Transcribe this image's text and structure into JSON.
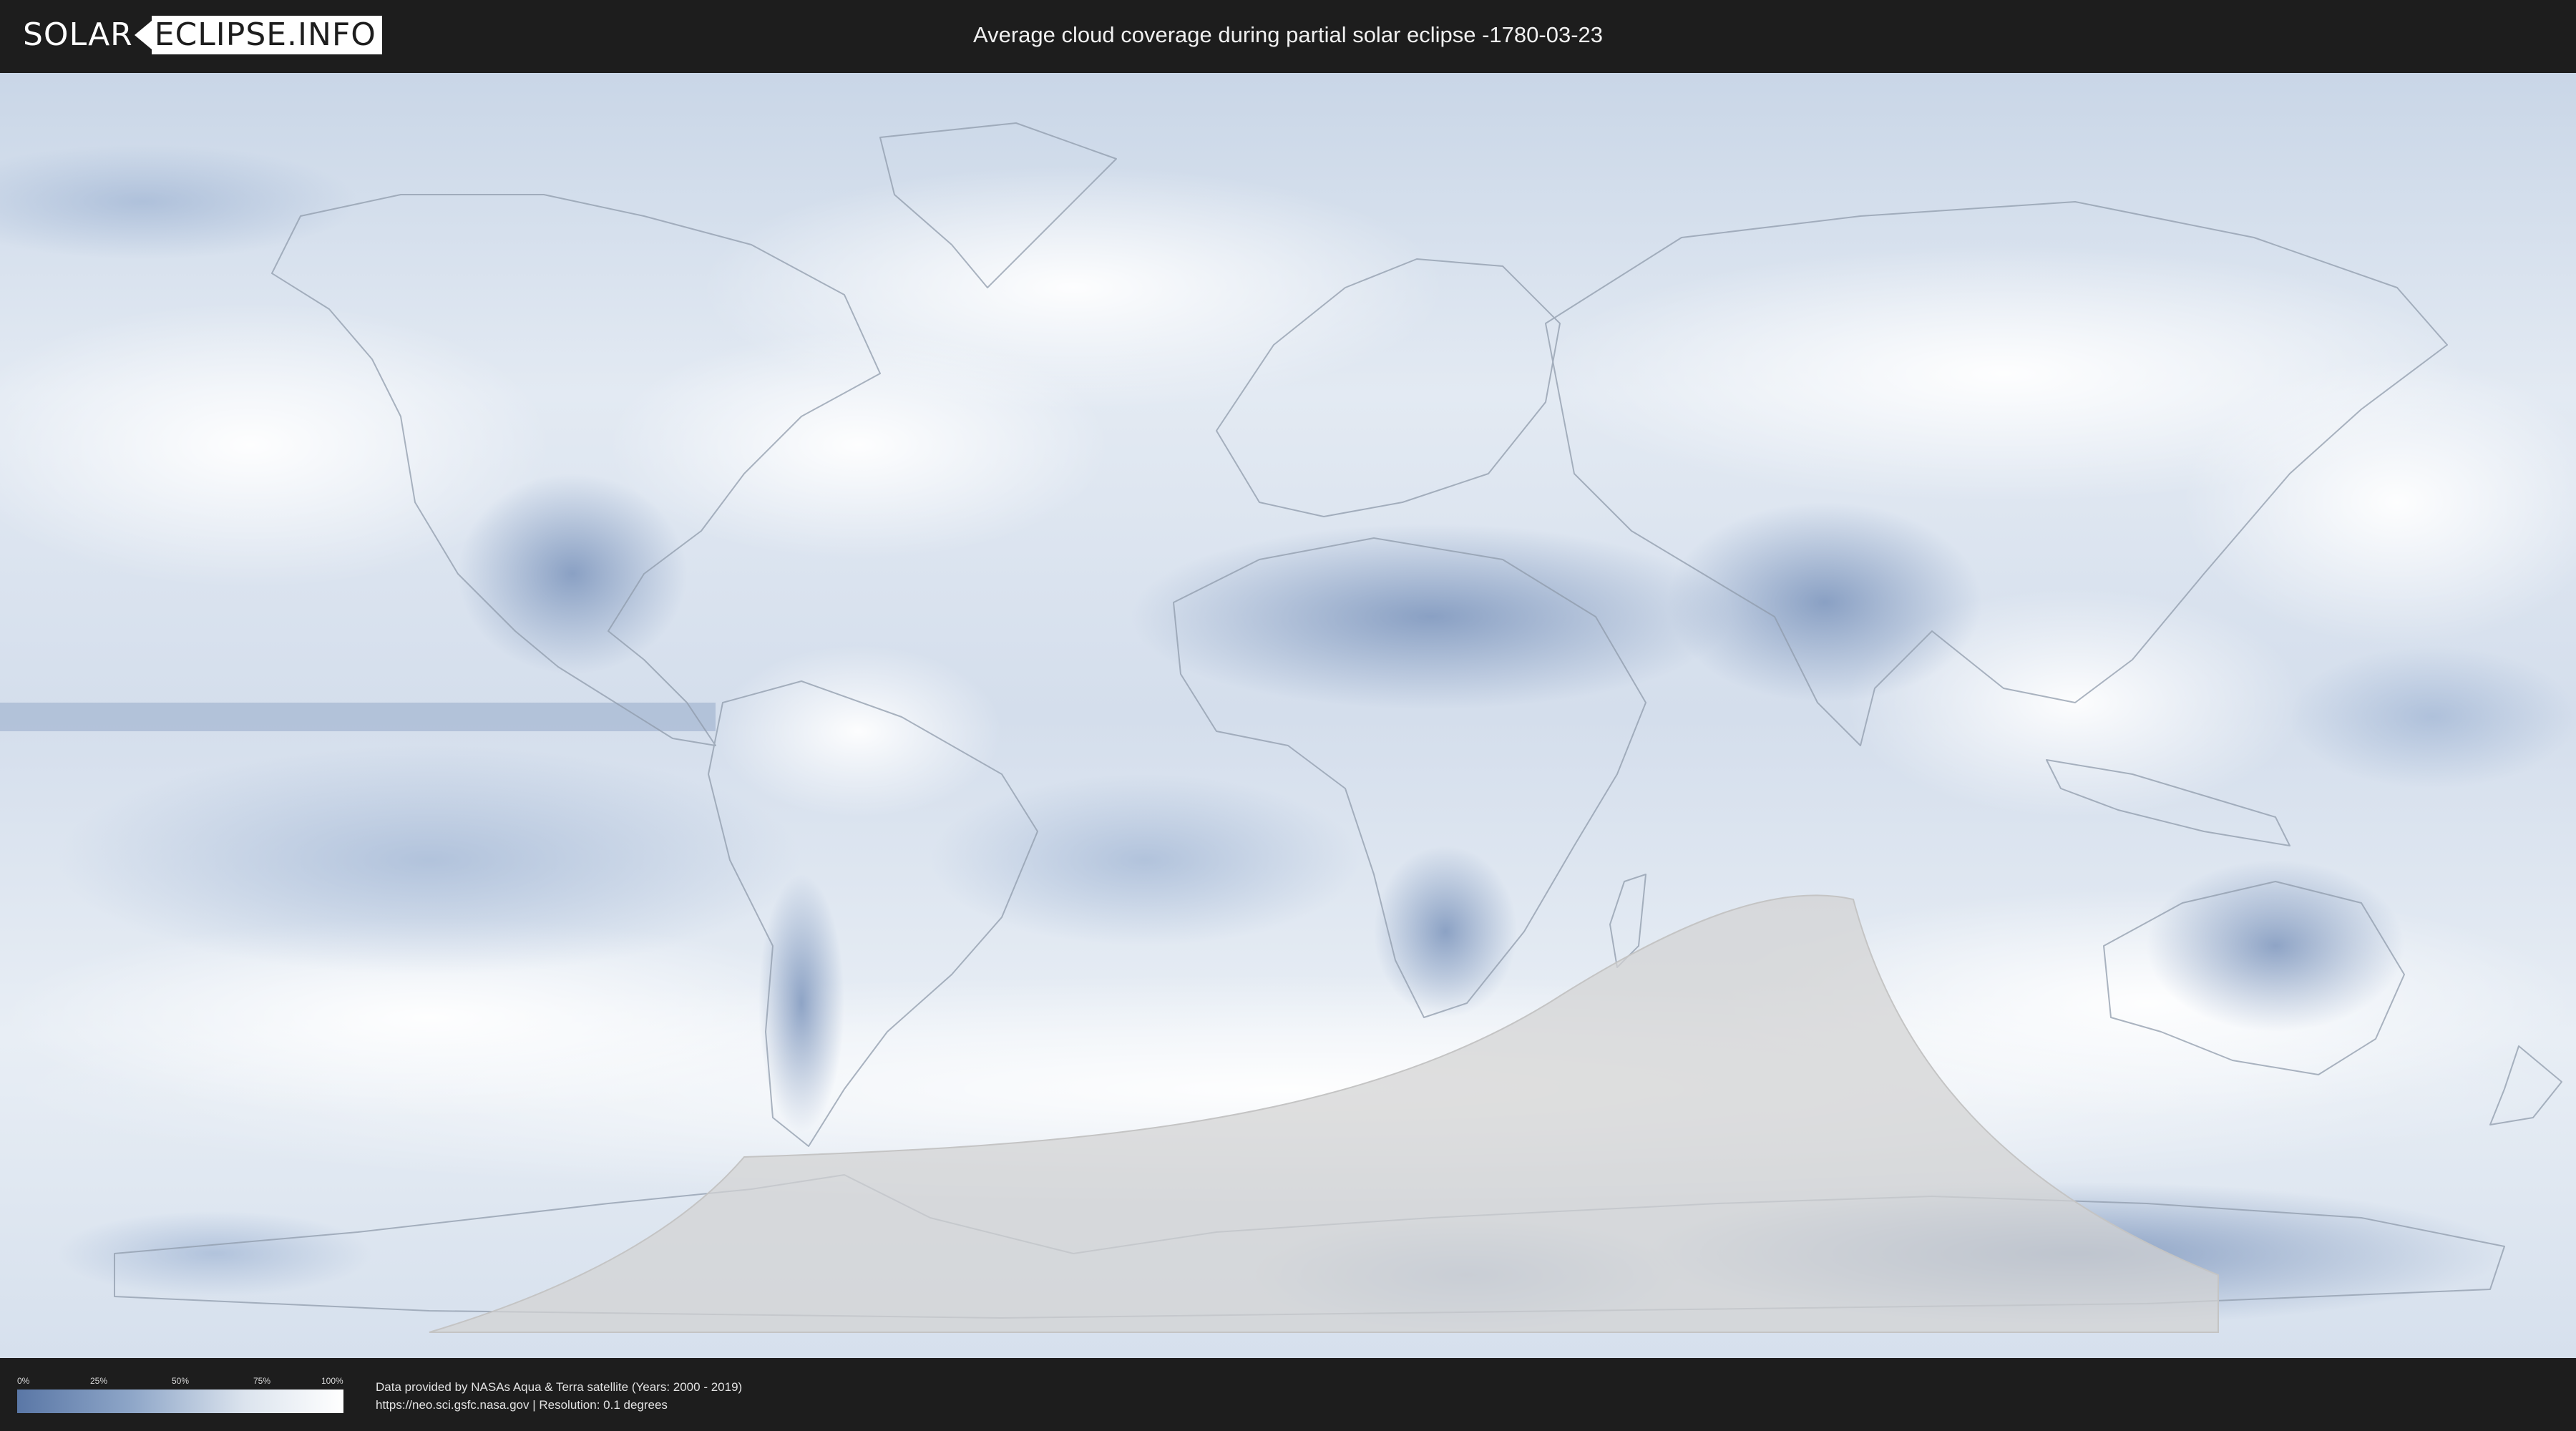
{
  "header": {
    "logo_part1": "SOLAR",
    "logo_part2": "ECLIPSE.INFO",
    "title": "Average cloud coverage during partial solar eclipse -1780-03-23"
  },
  "map": {
    "projection": "equirectangular",
    "layer": "average cloud coverage",
    "eclipse_visibility_region": "partial eclipse zone (grey shaded area, southern ocean / Antarctica)",
    "colors": {
      "low_cloud": "#5a77a6",
      "high_cloud": "#ffffff",
      "eclipse_zone": "#d0d0d0"
    }
  },
  "legend": {
    "ticks": [
      "0%",
      "25%",
      "50%",
      "75%",
      "100%"
    ]
  },
  "credits": {
    "line1": "Data provided by NASAs Aqua & Terra satellite (Years: 2000 - 2019)",
    "line2": "https://neo.sci.gsfc.nasa.gov | Resolution: 0.1 degrees"
  }
}
